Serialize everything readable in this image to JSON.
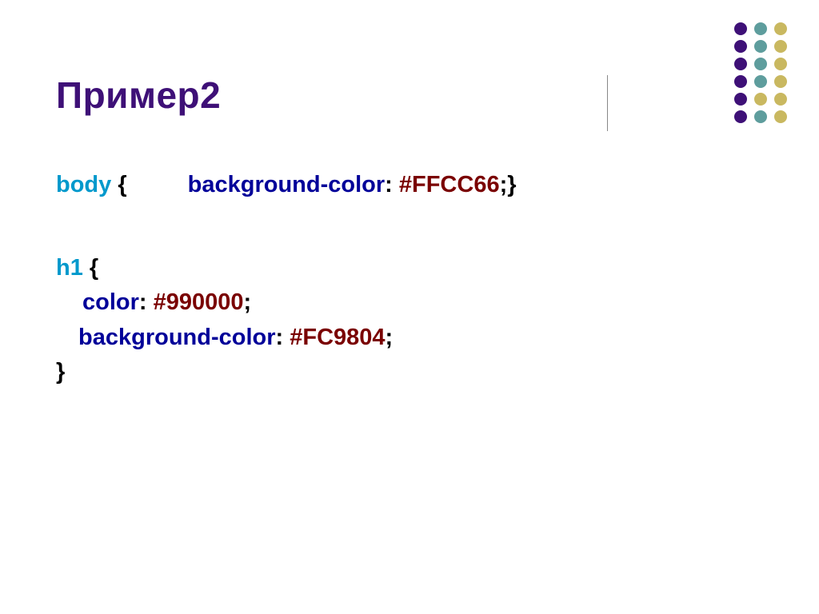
{
  "title": "Пример2",
  "code": {
    "line1": {
      "selector": "body",
      "brace_open": " {",
      "property": "background-color",
      "colon": ":",
      "value": " #FFCC66",
      "semi": ";",
      "brace_close": "}"
    },
    "line2": {
      "selector": "h1",
      "brace_open": " {"
    },
    "line3": {
      "property": "color",
      "colon": ":",
      "value": " #990000",
      "semi": ";"
    },
    "line4": {
      "property": "background-color",
      "colon": ":",
      "value": " #FC9804",
      "semi": ";"
    },
    "line5": {
      "brace_close": "}"
    }
  },
  "decoration": {
    "colors": {
      "purple": "#3E1077",
      "teal": "#5E9D9D",
      "gold": "#C9B860"
    }
  }
}
